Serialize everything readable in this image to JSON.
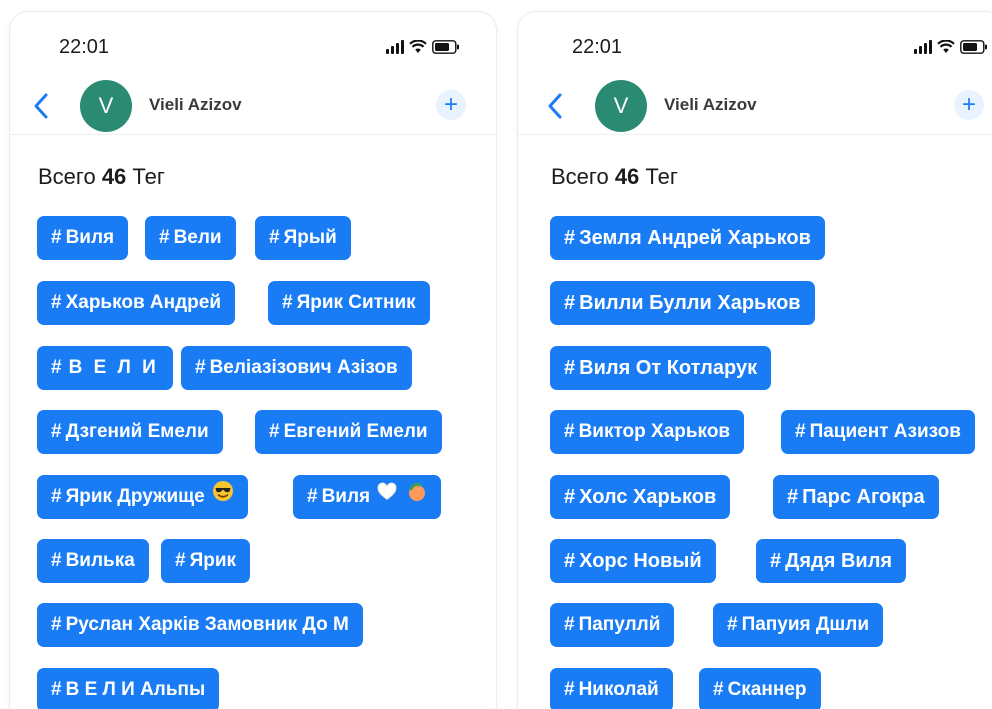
{
  "colors": {
    "accent": "#1a7cf5",
    "avatar": "#2b8a72",
    "add_button_bg": "#e9f2ff",
    "text_dark": "#1c1c1e"
  },
  "screens": [
    {
      "status": {
        "time": "22:01"
      },
      "nav": {
        "back_icon": "chevron-left-icon",
        "avatar_letter": "V",
        "contact_name": "Vieli Azizov",
        "add_label": "+"
      },
      "heading": {
        "prefix": "Всего",
        "count": "46",
        "suffix": "Тег"
      },
      "tags": [
        {
          "hash": "#",
          "label": "Виля"
        },
        {
          "hash": "#",
          "label": "Вели"
        },
        {
          "hash": "#",
          "label": "Ярый"
        },
        {
          "hash": "#",
          "label": "Харьков Андрей"
        },
        {
          "hash": "#",
          "label": "Ярик Ситник"
        },
        {
          "hash": "#",
          "label": "В Е Л И"
        },
        {
          "hash": "#",
          "label": "Веліазізович Азізов"
        },
        {
          "hash": "#",
          "label": "Дзгений Емели"
        },
        {
          "hash": "#",
          "label": "Евгений Емели"
        },
        {
          "hash": "#",
          "label": "Ярик Дружище",
          "emoji": "smiling-face-with-sunglasses-icon"
        },
        {
          "hash": "#",
          "label": "Виля",
          "emoji": "white-heart-and-peach-icon"
        },
        {
          "hash": "#",
          "label": "Вилька"
        },
        {
          "hash": "#",
          "label": "Ярик"
        },
        {
          "hash": "#",
          "label": "Руслан Харків Замовник До М"
        },
        {
          "hash": "#",
          "label": "В Е Л И Альпы"
        }
      ]
    },
    {
      "status": {
        "time": "22:01"
      },
      "nav": {
        "back_icon": "chevron-left-icon",
        "avatar_letter": "V",
        "contact_name": "Vieli Azizov",
        "add_label": "+"
      },
      "heading": {
        "prefix": "Всего",
        "count": "46",
        "suffix": "Тег"
      },
      "tags": [
        {
          "hash": "#",
          "label": "Земля Андрей Харьков"
        },
        {
          "hash": "#",
          "label": "Вилли Булли Харьков"
        },
        {
          "hash": "#",
          "label": "Виля От Котларук"
        },
        {
          "hash": "#",
          "label": "Виктор Харьков"
        },
        {
          "hash": "#",
          "label": "Пациент Азизов"
        },
        {
          "hash": "#",
          "label": "Холс Харьков"
        },
        {
          "hash": "#",
          "label": "Парс Агокра"
        },
        {
          "hash": "#",
          "label": "Хорс Новый"
        },
        {
          "hash": "#",
          "label": "Дядя Виля"
        },
        {
          "hash": "#",
          "label": "Папуллй"
        },
        {
          "hash": "#",
          "label": "Папуия Дшли"
        },
        {
          "hash": "#",
          "label": "Николай"
        },
        {
          "hash": "#",
          "label": "Сканнер"
        }
      ]
    }
  ]
}
